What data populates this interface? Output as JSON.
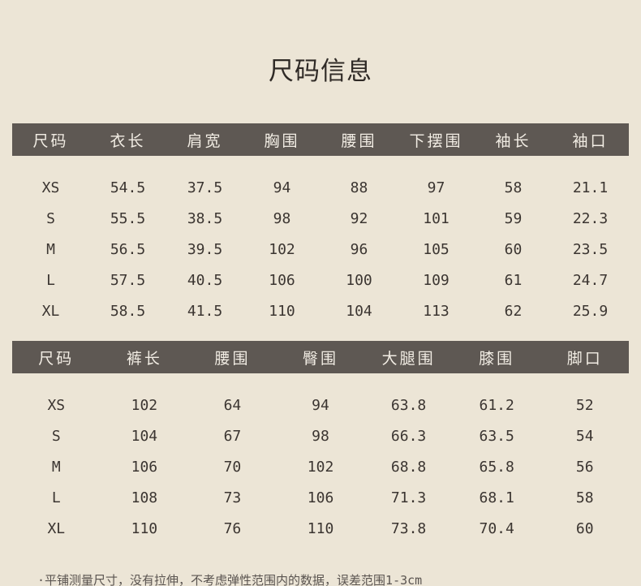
{
  "title": "尺码信息",
  "top_table": {
    "headers": [
      "尺码",
      "衣长",
      "肩宽",
      "胸围",
      "腰围",
      "下摆围",
      "袖长",
      "袖口"
    ],
    "rows": [
      [
        "XS",
        "54.5",
        "37.5",
        "94",
        "88",
        "97",
        "58",
        "21.1"
      ],
      [
        "S",
        "55.5",
        "38.5",
        "98",
        "92",
        "101",
        "59",
        "22.3"
      ],
      [
        "M",
        "56.5",
        "39.5",
        "102",
        "96",
        "105",
        "60",
        "23.5"
      ],
      [
        "L",
        "57.5",
        "40.5",
        "106",
        "100",
        "109",
        "61",
        "24.7"
      ],
      [
        "XL",
        "58.5",
        "41.5",
        "110",
        "104",
        "113",
        "62",
        "25.9"
      ]
    ]
  },
  "bottom_table": {
    "headers": [
      "尺码",
      "裤长",
      "腰围",
      "臀围",
      "大腿围",
      "膝围",
      "脚口"
    ],
    "rows": [
      [
        "XS",
        "102",
        "64",
        "94",
        "63.8",
        "61.2",
        "52"
      ],
      [
        "S",
        "104",
        "67",
        "98",
        "66.3",
        "63.5",
        "54"
      ],
      [
        "M",
        "106",
        "70",
        "102",
        "68.8",
        "65.8",
        "56"
      ],
      [
        "L",
        "108",
        "73",
        "106",
        "71.3",
        "68.1",
        "58"
      ],
      [
        "XL",
        "110",
        "76",
        "110",
        "73.8",
        "70.4",
        "60"
      ]
    ]
  },
  "note": "·平铺测量尺寸，没有拉伸，不考虑弹性范围内的数据，误差范围1-3cm",
  "colors": {
    "background": "#ece5d6",
    "header_bar": "#5e5853",
    "header_text": "#f2ede4",
    "body_text": "#3b3531"
  }
}
